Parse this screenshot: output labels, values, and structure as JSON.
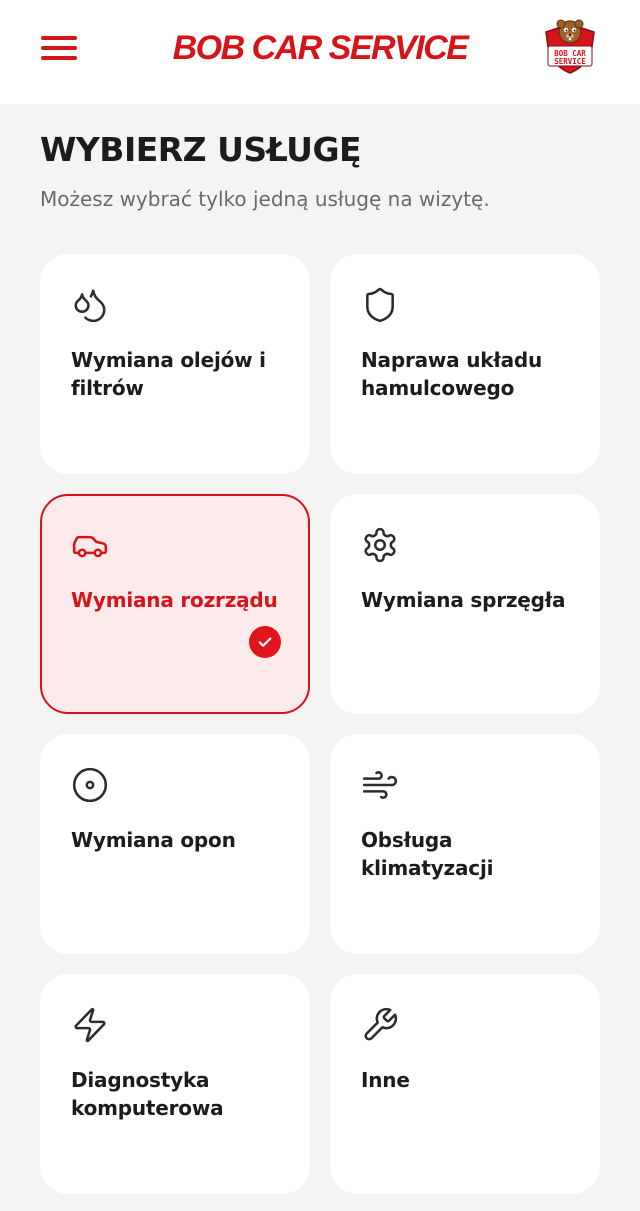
{
  "header": {
    "brand": "BOB CAR SERVICE",
    "logo_text_top": "BOB CAR",
    "logo_text_bottom": "SERVICE"
  },
  "page": {
    "title": "WYBIERZ USŁUGĘ",
    "subtitle": "Możesz wybrać tylko jedną usługę na wizytę."
  },
  "services": [
    {
      "label": "Wymiana olejów i filtrów",
      "icon": "oil-drops-icon",
      "selected": false
    },
    {
      "label": "Naprawa układu hamulcowego",
      "icon": "shield-icon",
      "selected": false
    },
    {
      "label": "Wymiana rozrządu",
      "icon": "car-icon",
      "selected": true
    },
    {
      "label": "Wymiana sprzęgła",
      "icon": "gear-icon",
      "selected": false
    },
    {
      "label": "Wymiana opon",
      "icon": "disc-icon",
      "selected": false
    },
    {
      "label": "Obsługa klimatyzacji",
      "icon": "wind-icon",
      "selected": false
    },
    {
      "label": "Diagnostyka komputerowa",
      "icon": "lightning-icon",
      "selected": false
    },
    {
      "label": "Inne",
      "icon": "wrench-icon",
      "selected": false
    }
  ],
  "colors": {
    "accent": "#d7141a",
    "background": "#f4f4f4",
    "card": "#ffffff",
    "selected_card": "#fdebeb",
    "text": "#1c1c1c",
    "muted": "#6a6a6a"
  }
}
